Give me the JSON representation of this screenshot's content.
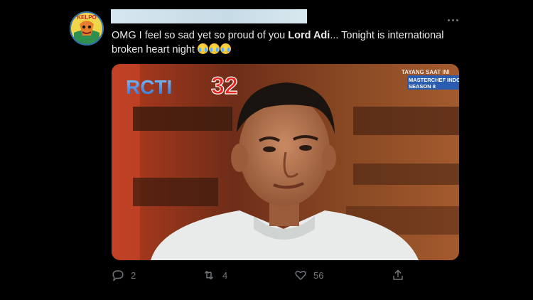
{
  "tweet": {
    "text_before": "OMG I feel so sad yet so proud of you ",
    "text_bold": "Lord Adi",
    "text_after": "... Tonight is international broken heart night",
    "emoji_name": "loudly-crying-face"
  },
  "avatar": {
    "logo_text": "KELPO"
  },
  "media": {
    "channel_logo": "RCTI",
    "channel_number": "32",
    "overlay_line1": "TAYANG SAAT INI",
    "overlay_line2": "MASTERCHEF INDONESIA",
    "overlay_line3": "SEASON 8"
  },
  "actions": {
    "replies": "2",
    "retweets": "4",
    "likes": "56"
  },
  "colors": {
    "background": "#000000",
    "text": "#e7e9ea",
    "muted": "#71767b"
  }
}
